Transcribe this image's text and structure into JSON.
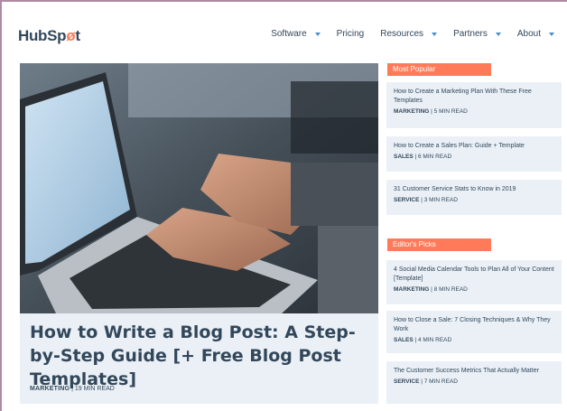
{
  "header": {
    "logo_text_a": "HubSp",
    "logo_sprocket": "ø",
    "logo_text_b": "t",
    "nav": [
      {
        "label": "Software",
        "has_caret": true
      },
      {
        "label": "Pricing",
        "has_caret": false
      },
      {
        "label": "Resources",
        "has_caret": true
      },
      {
        "label": "Partners",
        "has_caret": true
      },
      {
        "label": "About",
        "has_caret": true
      }
    ]
  },
  "featured": {
    "title": "How to Write a Blog Post: A Step-by-Step Guide [+ Free Blog Post Templates]",
    "category": "MARKETING",
    "separator": " | ",
    "read_time": "19 MIN READ"
  },
  "most_popular": {
    "label": "Most Popular",
    "articles": [
      {
        "title": "How to Create a Marketing Plan With These Free Templates",
        "category": "MARKETING",
        "separator": " | ",
        "read_time": "5 MIN READ"
      },
      {
        "title": "How to Create a Sales Plan: Guide + Template",
        "category": "SALES",
        "separator": " | ",
        "read_time": "6 MIN READ"
      },
      {
        "title": "31 Customer Service Stats to Know in 2019",
        "category": "SERVICE",
        "separator": " | ",
        "read_time": "3 MIN READ"
      }
    ]
  },
  "editors_picks": {
    "label": "Editor's Picks",
    "articles": [
      {
        "title": "4 Social Media Calendar Tools to Plan All of Your Content [Template]",
        "category": "MARKETING",
        "separator": " | ",
        "read_time": "8 MIN READ"
      },
      {
        "title": "How to Close a Sale: 7 Closing Techniques & Why They Work",
        "category": "SALES",
        "separator": " | ",
        "read_time": "4 MIN READ"
      },
      {
        "title": "The Customer Success Metrics That Actually Matter",
        "category": "SERVICE",
        "separator": " | ",
        "read_time": "7 MIN READ"
      }
    ]
  },
  "colors": {
    "accent": "#ff7a59",
    "text": "#33475b",
    "card_bg": "#eaf0f6",
    "caret": "#4a90c8"
  }
}
